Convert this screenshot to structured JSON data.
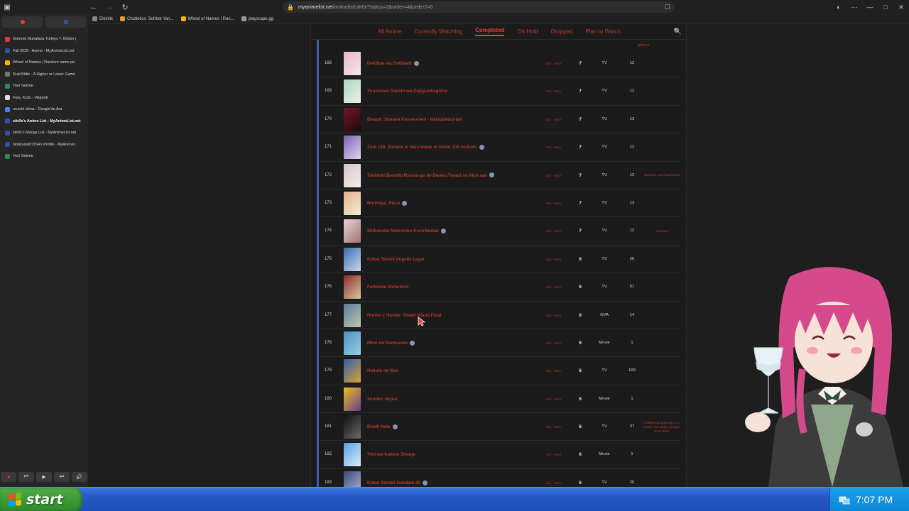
{
  "browser": {
    "url_host": "myanimelist.net",
    "url_path": "/animelist/sitr0x?status=2&order=4&order2=0",
    "bookmarks": [
      "Etkinlik",
      "Chatletics: Sohbet Yari...",
      "Wheel of Names | Ran...",
      "playscape.gg"
    ]
  },
  "sidebar": {
    "tabs": [
      {
        "label": "Gümrük Muhafaza Türkiye 7. Bölüm |",
        "color": "#e53935"
      },
      {
        "label": "Fall 2025 - Anime - MyAnimeList.net",
        "color": "#2e51a2"
      },
      {
        "label": "Wheel of Names | Random name pic",
        "color": "#f4b400"
      },
      {
        "label": "Rule34dle - A Higher or Lower Game",
        "color": "#777777"
      },
      {
        "label": "Yeni Sekme",
        "color": "#2e8b57"
      },
      {
        "label": "Futa, Kızlu - Vikipedi",
        "color": "#dddddd"
      },
      {
        "label": "urumki china - Google'da Ara",
        "color": "#4285f4"
      },
      {
        "label": "sitr0x's Anime List - MyAnimeList.net",
        "color": "#2e51a2",
        "active": true
      },
      {
        "label": "sitr0x's Manga List - MyAnimeList.net",
        "color": "#2e51a2"
      },
      {
        "label": "NoNoubdiTOS4's Profile - MyAnimeL",
        "color": "#2e51a2"
      },
      {
        "label": "Yeni Sekme",
        "color": "#2e8b57"
      }
    ]
  },
  "statusnav": [
    "All Anime",
    "Currently Watching",
    "Completed",
    "On Hold",
    "Dropped",
    "Plan to Watch"
  ],
  "statusnav_selected": "Completed",
  "top_note": "girlsrev",
  "edit_label": "Add - More",
  "rows": [
    {
      "num": "168",
      "title": "Dekiftan wa Oshibaiti",
      "info": true,
      "score": "7",
      "type": "TV",
      "eps": "12",
      "tags": "",
      "c1": "#e8b7c9",
      "c2": "#f6e6ee"
    },
    {
      "num": "169",
      "title": "Yuusenian Danshi wa Gaijiyuuhagisho",
      "info": false,
      "score": "7",
      "type": "TV",
      "eps": "12",
      "tags": "",
      "c1": "#a8d5c6",
      "c2": "#f2efe6"
    },
    {
      "num": "170",
      "title": "Bleach: Sennen Kessen-hen - Ketsubetsu-tan",
      "info": false,
      "score": "7",
      "type": "TV",
      "eps": "13",
      "tags": "",
      "c1": "#7a1424",
      "c2": "#1a0a0e"
    },
    {
      "num": "171",
      "title": "Zom 100: Zombie ni Naru made ni Shitai 100 no Koto",
      "info": true,
      "score": "7",
      "type": "TV",
      "eps": "12",
      "tags": "",
      "c1": "#7a5fb0",
      "c2": "#e0d6f0"
    },
    {
      "num": "172",
      "title": "Tokidoki Bosotto Russia-go de Dereru Tonari no Alya-san",
      "info": true,
      "score": "7",
      "type": "TV",
      "eps": "12",
      "tags": "death by us2 couphedon",
      "c1": "#d9c4c4",
      "c2": "#f6efe9"
    },
    {
      "num": "173",
      "title": "Horimiya: Piece",
      "info": true,
      "score": "7",
      "type": "TV",
      "eps": "13",
      "tags": "",
      "c1": "#e2b38a",
      "c2": "#f4ead6"
    },
    {
      "num": "174",
      "title": "Shikanoko Nokonoko Koshitantan",
      "info": true,
      "score": "7",
      "type": "TV",
      "eps": "12",
      "tags": "Comedy",
      "c1": "#e5d5d5",
      "c2": "#a47272"
    },
    {
      "num": "175",
      "title": "Kidou Tenshi Angelic Layer",
      "info": false,
      "score": "6",
      "type": "TV",
      "eps": "26",
      "tags": "",
      "c1": "#3a6cb0",
      "c2": "#c9d9ea"
    },
    {
      "num": "176",
      "title": "Fullmetal Alchemist",
      "info": false,
      "score": "6",
      "type": "TV",
      "eps": "51",
      "tags": "",
      "c1": "#8a2d2d",
      "c2": "#d8c6a0"
    },
    {
      "num": "177",
      "title": "Hunter x Hunter: Greed Island Final",
      "info": false,
      "score": "6",
      "type": "OVA",
      "eps": "14",
      "tags": "",
      "c1": "#5a7a9a",
      "c2": "#c0c8b0"
    },
    {
      "num": "178",
      "title": "Mimi wo Sumaseba",
      "info": true,
      "score": "6",
      "type": "Movie",
      "eps": "1",
      "tags": "",
      "c1": "#4a90c0",
      "c2": "#9ad0e6"
    },
    {
      "num": "179",
      "title": "Hokuto no Ken",
      "info": false,
      "score": "6",
      "type": "TV",
      "eps": "109",
      "tags": "",
      "c1": "#2a5fb0",
      "c2": "#e0a030"
    },
    {
      "num": "180",
      "title": "Sennen Joyuu",
      "info": false,
      "score": "6",
      "type": "Movie",
      "eps": "1",
      "tags": "",
      "c1": "#e8c020",
      "c2": "#6a3a90"
    },
    {
      "num": "181",
      "title": "Death Note",
      "info": true,
      "score": "6",
      "type": "TV",
      "eps": "37",
      "tags": "Gideonnat baştanga, LA LIGHT son dağı, yosuga, Kout Hene",
      "c1": "#101010",
      "c2": "#6a6a6a"
    },
    {
      "num": "182",
      "title": "Toki wo Kakeru Shoujo",
      "info": false,
      "score": "6",
      "type": "Movie",
      "eps": "1",
      "tags": "",
      "c1": "#5aa0e0",
      "c2": "#d6eefa"
    },
    {
      "num": "183",
      "title": "Kidou Senshi Gundam 00",
      "info": true,
      "score": "6",
      "type": "TV",
      "eps": "25",
      "tags": "",
      "c1": "#3a4a7a",
      "c2": "#b0b8d0"
    }
  ],
  "taskbar": {
    "start_label": "start",
    "clock": "7:07 PM"
  },
  "colors": {
    "accent_red": "#c0392b",
    "mal_blue": "#3b5ba8",
    "xp_blue": "#2458c6",
    "xp_green": "#3b9a37"
  },
  "icons": [
    "back-icon",
    "forward-icon",
    "reload-icon",
    "lock-icon",
    "bookmark-star-icon",
    "search-icon",
    "play-icon",
    "prev-icon",
    "next-icon",
    "volume-icon",
    "windows-flag-icon",
    "network-tray-icon"
  ]
}
